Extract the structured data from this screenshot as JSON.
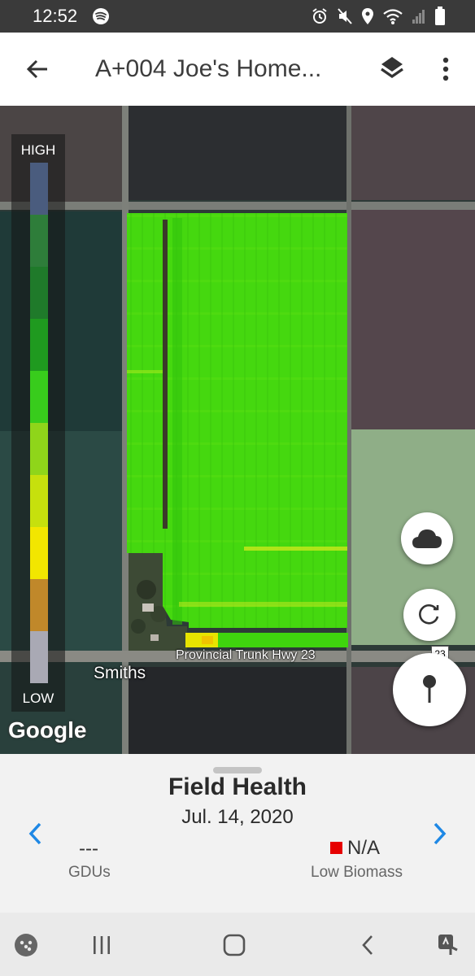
{
  "status_bar": {
    "time": "12:52",
    "left_icons": [
      "spotify-icon"
    ],
    "right_icons": [
      "alarm-icon",
      "mute-icon",
      "location-icon",
      "wifi-icon",
      "signal-icon",
      "battery-icon"
    ]
  },
  "app_bar": {
    "title": "A+004 Joe's Home...",
    "back_icon": "arrow-back-icon",
    "layers_icon": "layers-icon",
    "more_icon": "more-vert-icon"
  },
  "map": {
    "legend": {
      "high_label": "HIGH",
      "low_label": "LOW",
      "colors": [
        "#4a5c7e",
        "#2e7d3a",
        "#1f7a2a",
        "#1f9a1f",
        "#2ab71e",
        "#38cc1c",
        "#8fd51a",
        "#c6e00d",
        "#f2e600",
        "#c0882a",
        "#a9a9b4"
      ]
    },
    "road_label": "Provincial Trunk Hwy 23",
    "town_label": "Smiths",
    "highway_shield": "23",
    "attribution": "Google",
    "buttons": {
      "cloud": "cloud-icon",
      "refresh": "refresh-icon",
      "pin": "map-pin-icon"
    }
  },
  "sheet": {
    "title": "Field Health",
    "date": "Jul. 14, 2020",
    "left_metric": {
      "value": "---",
      "label": "GDUs"
    },
    "right_metric": {
      "value": "N/A",
      "label": "Low Biomass",
      "indicator_color": "#e60000"
    },
    "accent_color": "#1e88e5"
  },
  "system_nav": {
    "buttons": [
      "assistant-icon",
      "recents-icon",
      "home-icon",
      "back-icon",
      "accessibility-icon"
    ]
  }
}
